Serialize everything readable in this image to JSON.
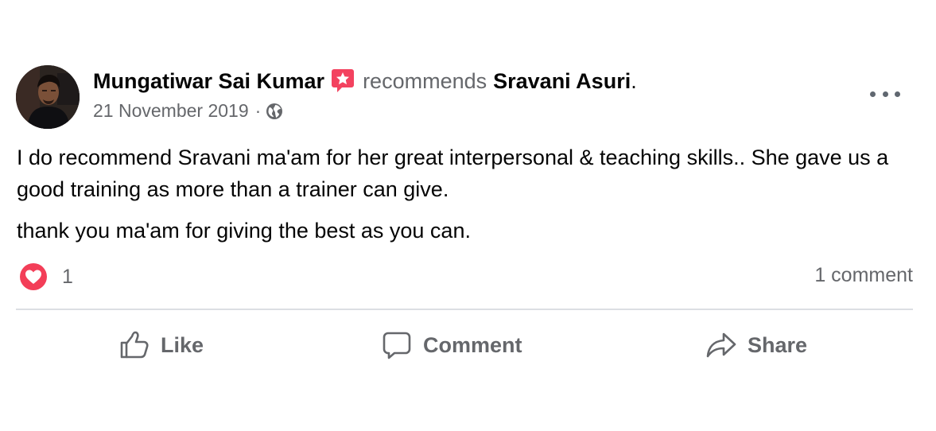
{
  "post": {
    "author": "Mungatiwar Sai Kumar",
    "verb": "recommends",
    "recipient": "Sravani Asuri",
    "recipient_suffix": ".",
    "date": "21 November 2019",
    "meta_separator": "·",
    "audience_icon": "globe-icon",
    "body": [
      "I do recommend Sravani ma'am for her great interpersonal & teaching skills.. She gave us a good training as more than a trainer can give.",
      "thank you ma'am for giving the best as you can."
    ]
  },
  "engagement": {
    "reaction_icon": "love-icon",
    "reaction_count": "1",
    "comments_text": "1 comment"
  },
  "actions": {
    "like_label": "Like",
    "comment_label": "Comment",
    "share_label": "Share"
  },
  "colors": {
    "primary_text": "#050505",
    "secondary_text": "#65676b",
    "recommend_badge": "#f3425f",
    "love_reaction": "#f33e58",
    "divider": "#dcdfe3"
  }
}
